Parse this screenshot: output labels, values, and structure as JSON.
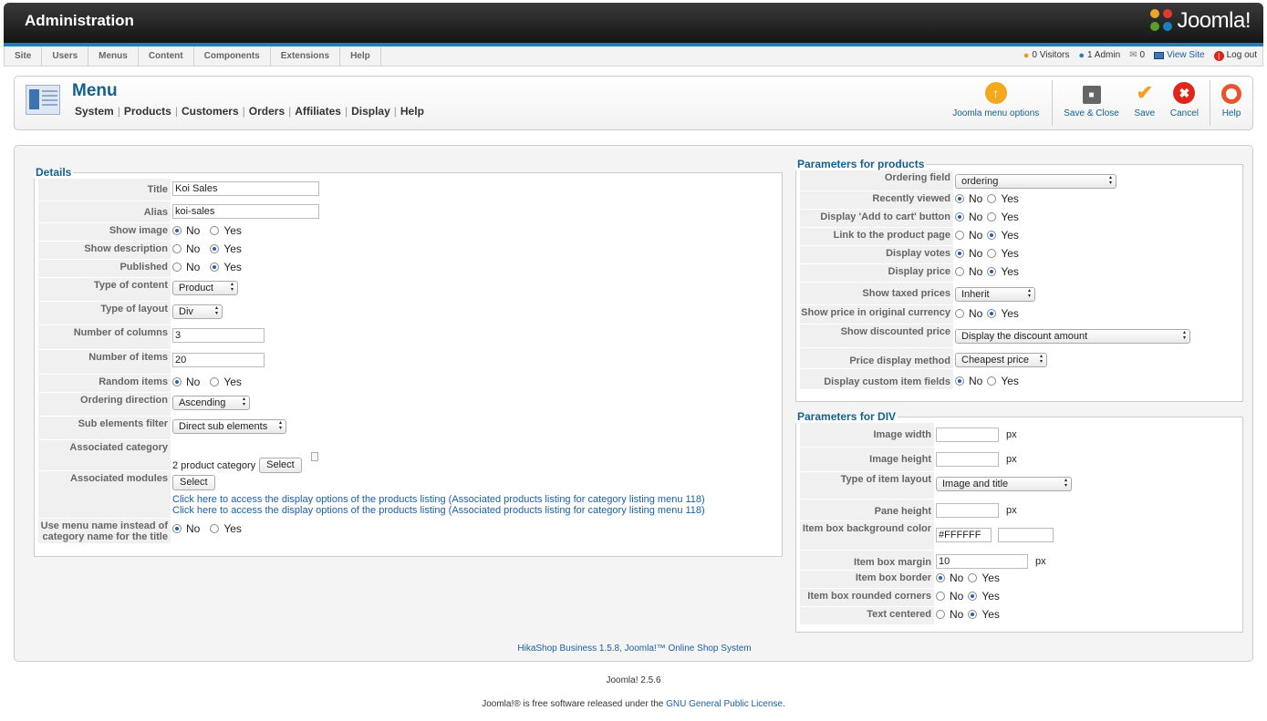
{
  "header": {
    "title": "Administration",
    "logo_text": "Joomla!"
  },
  "menubar": {
    "items": [
      "Site",
      "Users",
      "Menus",
      "Content",
      "Components",
      "Extensions",
      "Help"
    ],
    "visitors": "0 Visitors",
    "admins": "1 Admin",
    "messages": "0",
    "view_site": "View Site",
    "logout": "Log out"
  },
  "toolbar": {
    "page_title": "Menu",
    "submenu": [
      "System",
      "Products",
      "Customers",
      "Orders",
      "Affiliates",
      "Display",
      "Help"
    ],
    "buttons": {
      "menu_options": "Joomla menu options",
      "save_close": "Save & Close",
      "save": "Save",
      "cancel": "Cancel",
      "help": "Help"
    }
  },
  "details": {
    "legend": "Details",
    "title_label": "Title",
    "title_value": "Koi Sales",
    "alias_label": "Alias",
    "alias_value": "koi-sales",
    "show_image_label": "Show image",
    "show_description_label": "Show description",
    "published_label": "Published",
    "type_content_label": "Type of content",
    "type_content_value": "Product",
    "type_layout_label": "Type of layout",
    "type_layout_value": "Div",
    "num_columns_label": "Number of columns",
    "num_columns_value": "3",
    "num_items_label": "Number of items",
    "num_items_value": "20",
    "random_items_label": "Random items",
    "ordering_direction_label": "Ordering direction",
    "ordering_direction_value": "Ascending",
    "sub_filter_label": "Sub elements filter",
    "sub_filter_value": "Direct sub elements",
    "assoc_category_label": "Associated category",
    "assoc_category_value": "2 product category",
    "select_label": "Select",
    "assoc_modules_label": "Associated modules",
    "link1": "Click here to access the display options of the products listing (Associated products listing for category listing menu 118)",
    "link2": "Click here to access the display options of the products listing (Associated products listing for category listing menu 118)",
    "use_menu_name_label_1": "Use menu name instead of",
    "use_menu_name_label_2": "category name for the title",
    "no": "No",
    "yes": "Yes"
  },
  "products": {
    "legend": "Parameters for products",
    "ordering_field_label": "Ordering field",
    "ordering_field_value": "ordering",
    "recently_viewed_label": "Recently viewed",
    "add_to_cart_label": "Display 'Add to cart' button",
    "link_product_label": "Link to the product page",
    "display_votes_label": "Display votes",
    "display_price_label": "Display price",
    "taxed_prices_label": "Show taxed prices",
    "taxed_prices_value": "Inherit",
    "original_currency_label": "Show price in original currency",
    "discounted_price_label": "Show discounted price",
    "discounted_price_value": "Display the discount amount",
    "price_method_label": "Price display method",
    "price_method_value": "Cheapest price",
    "custom_fields_label": "Display custom item fields"
  },
  "div_params": {
    "legend": "Parameters for DIV",
    "image_width_label": "Image width",
    "image_height_label": "Image height",
    "item_layout_label": "Type of item layout",
    "item_layout_value": "Image and title",
    "pane_height_label": "Pane height",
    "bg_color_label": "Item box background color",
    "bg_color_value": "#FFFFFF",
    "box_margin_label": "Item box margin",
    "box_margin_value": "10",
    "box_border_label": "Item box border",
    "rounded_corners_label": "Item box rounded corners",
    "text_centered_label": "Text centered",
    "px": "px"
  },
  "footer": {
    "hikashop": "HikaShop Business 1.5.8, Joomla!™ Online Shop System",
    "version": "Joomla! 2.5.6",
    "license_prefix": "Joomla!® is free software released under the ",
    "license_link": "GNU General Public License",
    "license_suffix": "."
  }
}
